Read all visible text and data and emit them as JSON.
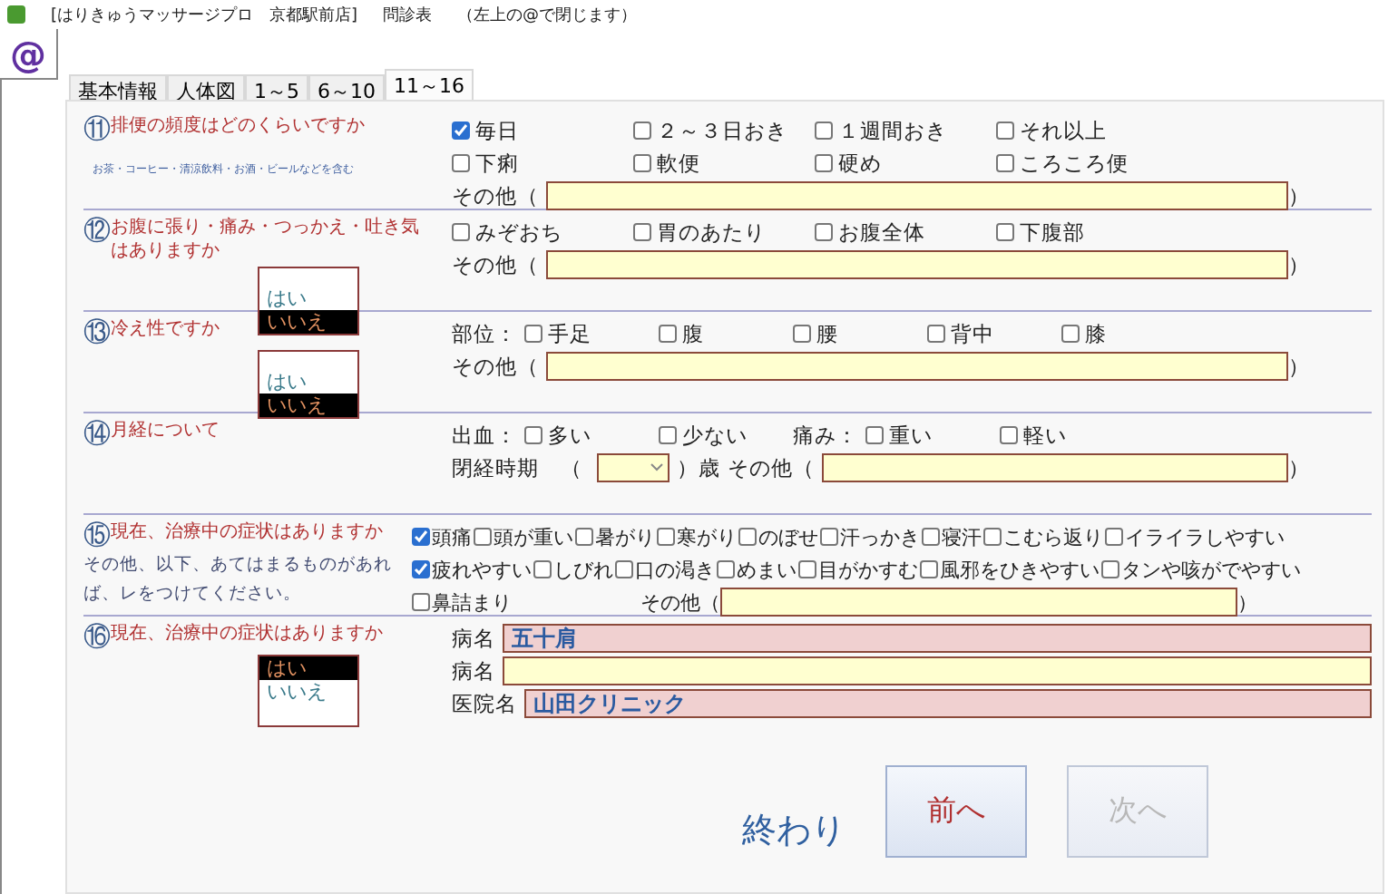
{
  "title_bar": {
    "app": "[はりきゅうマッサージプロ　京都駅前店]",
    "screen": "問診表",
    "hint": "（左上の@で閉じます）"
  },
  "close_button": "@",
  "tabs": [
    {
      "label": "基本情報",
      "selected": false
    },
    {
      "label": "人体図",
      "selected": false
    },
    {
      "label": "1～5",
      "selected": false
    },
    {
      "label": "6～10",
      "selected": false
    },
    {
      "label": "11～16",
      "selected": true
    }
  ],
  "sections": [
    {
      "number": "⑪",
      "question": "排便の頻度はどのくらいですか",
      "note": "お茶・コーヒー・清涼飲料・お酒・ビールなどを含む",
      "rows": [
        [
          {
            "kind": "check",
            "label": "毎日",
            "checked": true
          },
          {
            "kind": "check",
            "label": "２～３日おき",
            "checked": false
          },
          {
            "kind": "check",
            "label": "１週間おき",
            "checked": false
          },
          {
            "kind": "check",
            "label": "それ以上",
            "checked": false
          }
        ],
        [
          {
            "kind": "check",
            "label": "下痢",
            "checked": false
          },
          {
            "kind": "check",
            "label": "軟便",
            "checked": false
          },
          {
            "kind": "check",
            "label": "硬め",
            "checked": false
          },
          {
            "kind": "check",
            "label": "ころころ便",
            "checked": false
          }
        ],
        [
          {
            "kind": "label",
            "text": "その他（"
          },
          {
            "kind": "field",
            "highlight": false
          },
          {
            "kind": "label",
            "text": "）"
          }
        ]
      ]
    },
    {
      "number": "⑫",
      "question": "お腹に張り・痛み・つっかえ・吐き気はありますか",
      "choices": [
        {
          "label": "はい",
          "selected": false
        },
        {
          "label": "いいえ",
          "selected": true
        }
      ],
      "rows": [
        [
          {
            "kind": "check",
            "label": "みぞおち",
            "checked": false
          },
          {
            "kind": "check",
            "label": "胃のあたり",
            "checked": false
          },
          {
            "kind": "check",
            "label": "お腹全体",
            "checked": false
          },
          {
            "kind": "check",
            "label": "下腹部",
            "checked": false
          }
        ],
        [
          {
            "kind": "label",
            "text": "その他（"
          },
          {
            "kind": "field",
            "highlight": false
          },
          {
            "kind": "label",
            "text": "）"
          }
        ]
      ]
    },
    {
      "number": "⑬",
      "question": "冷え性ですか",
      "choices": [
        {
          "label": "はい",
          "selected": false
        },
        {
          "label": "いいえ",
          "selected": true
        }
      ],
      "rows": [
        [
          {
            "kind": "label",
            "text": "部位："
          },
          {
            "kind": "check",
            "label": "手足",
            "checked": false
          },
          {
            "kind": "check",
            "label": "腹",
            "checked": false
          },
          {
            "kind": "check",
            "label": "腰",
            "checked": false
          },
          {
            "kind": "check",
            "label": "背中",
            "checked": false
          },
          {
            "kind": "check",
            "label": "膝",
            "checked": false
          }
        ],
        [
          {
            "kind": "label",
            "text": "その他（"
          },
          {
            "kind": "field",
            "highlight": false
          },
          {
            "kind": "label",
            "text": "）"
          }
        ]
      ]
    },
    {
      "number": "⑭",
      "question": "月経について",
      "rows": [
        [
          {
            "kind": "label",
            "text": "出血："
          },
          {
            "kind": "check",
            "label": "多い",
            "checked": false
          },
          {
            "kind": "check",
            "label": "少ない",
            "checked": false
          },
          {
            "kind": "label",
            "text": "痛み："
          },
          {
            "kind": "check",
            "label": "重い",
            "checked": false
          },
          {
            "kind": "check",
            "label": "軽い",
            "checked": false
          }
        ],
        [
          {
            "kind": "label",
            "text": "閉経時期　（"
          },
          {
            "kind": "select"
          },
          {
            "kind": "label",
            "text": "）歳"
          },
          {
            "kind": "label",
            "text": "その他（"
          },
          {
            "kind": "field",
            "highlight": false
          },
          {
            "kind": "label",
            "text": "）"
          }
        ]
      ]
    },
    {
      "number": "⑮",
      "question": "現在、治療中の症状はありますか",
      "note": "その他、以下、あてはまるものがあれば、レをつけてください。",
      "items": [
        {
          "kind": "check",
          "label": "頭痛",
          "checked": true
        },
        {
          "kind": "check",
          "label": "頭が重い",
          "checked": false
        },
        {
          "kind": "check",
          "label": "暑がり",
          "checked": false
        },
        {
          "kind": "check",
          "label": "寒がり",
          "checked": false
        },
        {
          "kind": "check",
          "label": "のぼせ",
          "checked": false
        },
        {
          "kind": "check",
          "label": "汗っかき",
          "checked": false
        },
        {
          "kind": "check",
          "label": "寝汗",
          "checked": false
        },
        {
          "kind": "check",
          "label": "こむら返り",
          "checked": false
        },
        {
          "kind": "check",
          "label": "イライラしやすい",
          "checked": false
        },
        {
          "kind": "check",
          "label": "疲れやすい",
          "checked": true
        },
        {
          "kind": "check",
          "label": "しびれ",
          "checked": false
        },
        {
          "kind": "check",
          "label": "口の渇き",
          "checked": false
        },
        {
          "kind": "check",
          "label": "めまい",
          "checked": false
        },
        {
          "kind": "check",
          "label": "目がかすむ",
          "checked": false
        },
        {
          "kind": "check",
          "label": "風邪をひきやすい",
          "checked": false
        },
        {
          "kind": "check",
          "label": "タンや咳がでやすい",
          "checked": false
        },
        {
          "kind": "check",
          "label": "鼻詰まり",
          "checked": false
        },
        {
          "kind": "label",
          "text": "その他（"
        },
        {
          "kind": "field",
          "highlight": false
        },
        {
          "kind": "label",
          "text": "）"
        }
      ]
    },
    {
      "number": "⑯",
      "question": "現在、治療中の症状はありますか",
      "choices": [
        {
          "label": "はい",
          "selected": true
        },
        {
          "label": "いいえ",
          "selected": false
        }
      ],
      "rows": [
        [
          {
            "kind": "label",
            "text": "病名"
          },
          {
            "kind": "field",
            "value": "五十肩",
            "highlight": true
          }
        ],
        [
          {
            "kind": "label",
            "text": "病名"
          },
          {
            "kind": "field",
            "highlight": false
          }
        ],
        [
          {
            "kind": "label",
            "text": "医院名"
          },
          {
            "kind": "field",
            "value": "山田クリニック",
            "highlight": true
          }
        ]
      ]
    }
  ],
  "footer": {
    "finish": "終わり",
    "buttons": [
      {
        "label": "前へ",
        "disabled": false
      },
      {
        "label": "次へ",
        "disabled": true
      }
    ]
  }
}
